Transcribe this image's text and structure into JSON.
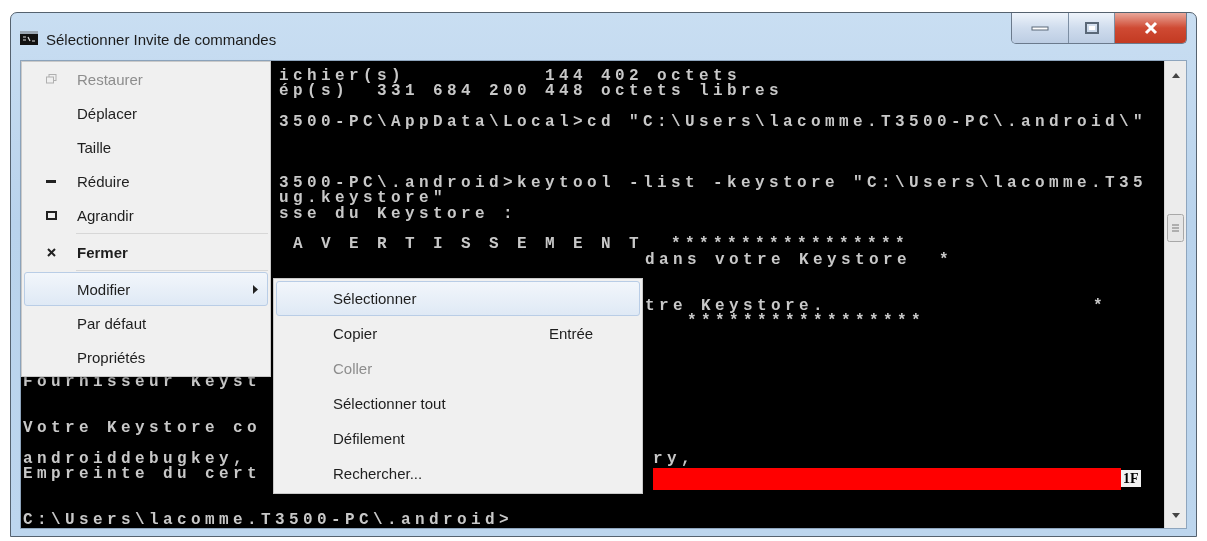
{
  "window": {
    "title": "Sélectionner Invite de commandes"
  },
  "console": {
    "lines": [
      {
        "kind": "after_menu",
        "text": "ichier(s)          144 402 octets"
      },
      {
        "kind": "after_menu",
        "text": "ép(s)  331 684 200 448 octets libres"
      },
      {
        "kind": "blank"
      },
      {
        "kind": "after_menu",
        "text": "3500-PC\\AppData\\Local>cd \"C:\\Users\\lacomme.T3500-PC\\.android\\\""
      },
      {
        "kind": "blank"
      },
      {
        "kind": "blank"
      },
      {
        "kind": "blank"
      },
      {
        "kind": "after_menu",
        "text": "3500-PC\\.android>keytool -list -keystore \"C:\\Users\\lacomme.T35"
      },
      {
        "kind": "after_menu",
        "text": "ug.keystore\""
      },
      {
        "kind": "after_menu",
        "text": "sse du Keystore :"
      },
      {
        "kind": "blank"
      },
      {
        "kind": "after_menu",
        "text": " A V E R T I S S E M E N T  *****************"
      },
      {
        "kind": "after_submenu",
        "text": "dans votre Keystore  *"
      },
      {
        "kind": "blank"
      },
      {
        "kind": "blank"
      },
      {
        "kind": "after_submenu",
        "text": "tre Keystore.                   *"
      },
      {
        "kind": "after_submenu",
        "text": "   *****************"
      },
      {
        "kind": "blank"
      },
      {
        "kind": "blank"
      },
      {
        "kind": "blank"
      },
      {
        "kind": "split",
        "left": "Fournisseur Keyst"
      },
      {
        "kind": "blank"
      },
      {
        "kind": "blank"
      },
      {
        "kind": "split",
        "left": "Votre Keystore co"
      },
      {
        "kind": "blank"
      },
      {
        "kind": "split",
        "left": "androiddebugkey,",
        "right": "ry,"
      },
      {
        "kind": "redacted",
        "left": "Empreinte du cert",
        "tail": "1F"
      },
      {
        "kind": "blank"
      },
      {
        "kind": "blank"
      },
      {
        "kind": "full",
        "text": "C:\\Users\\lacomme.T3500-PC\\.android>"
      }
    ]
  },
  "system_menu": {
    "items": [
      {
        "label": "Restaurer",
        "kind": "restore",
        "disabled": true,
        "selected": false
      },
      {
        "label": "Déplacer",
        "kind": "move",
        "disabled": false,
        "selected": false
      },
      {
        "label": "Taille",
        "kind": "size",
        "disabled": false,
        "selected": false
      },
      {
        "label": "Réduire",
        "kind": "minimize",
        "disabled": false,
        "selected": false
      },
      {
        "label": "Agrandir",
        "kind": "maximize",
        "disabled": false,
        "selected": false
      },
      {
        "label": "Fermer",
        "kind": "close",
        "disabled": false,
        "selected": false,
        "default": true,
        "separator_before": true
      },
      {
        "label": "Modifier",
        "kind": "edit",
        "disabled": false,
        "selected": true,
        "has_submenu": true,
        "separator_before": true
      },
      {
        "label": "Par défaut",
        "kind": "defaults",
        "disabled": false,
        "selected": false
      },
      {
        "label": "Propriétés",
        "kind": "properties",
        "disabled": false,
        "selected": false
      }
    ]
  },
  "submenu": {
    "items": [
      {
        "label": "Sélectionner",
        "disabled": false,
        "selected": true
      },
      {
        "label": "Copier",
        "shortcut": "Entrée",
        "disabled": false,
        "selected": false
      },
      {
        "label": "Coller",
        "disabled": true,
        "selected": false
      },
      {
        "label": "Sélectionner tout",
        "disabled": false,
        "selected": false
      },
      {
        "label": "Défilement",
        "disabled": false,
        "selected": false
      },
      {
        "label": "Rechercher...",
        "disabled": false,
        "selected": false
      }
    ]
  }
}
